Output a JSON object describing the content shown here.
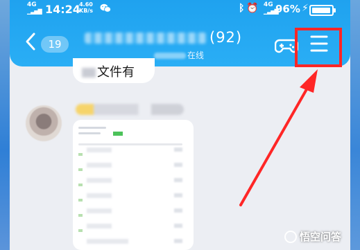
{
  "status_bar": {
    "network_1": "4G",
    "network_2": "4G",
    "time": "14:24",
    "speed_value": "4.60",
    "speed_unit": "KB/s",
    "icons": [
      "wechat-icon",
      "bluetooth-icon",
      "alarm-icon",
      "signal-icon",
      "signal-icon",
      "charging-icon",
      "battery-icon"
    ],
    "battery_percent": "96%",
    "battery_level": 0.96
  },
  "chat_header": {
    "unread_count": "19",
    "title_visible": "(92)",
    "status_text": "在线"
  },
  "messages": {
    "partial_bubble_text": "文件有"
  },
  "watermark": {
    "text": "悟空问答"
  },
  "colors": {
    "header_blue": "#2aaef5",
    "highlight_red": "#ff2626",
    "chat_background": "#eceef3"
  }
}
